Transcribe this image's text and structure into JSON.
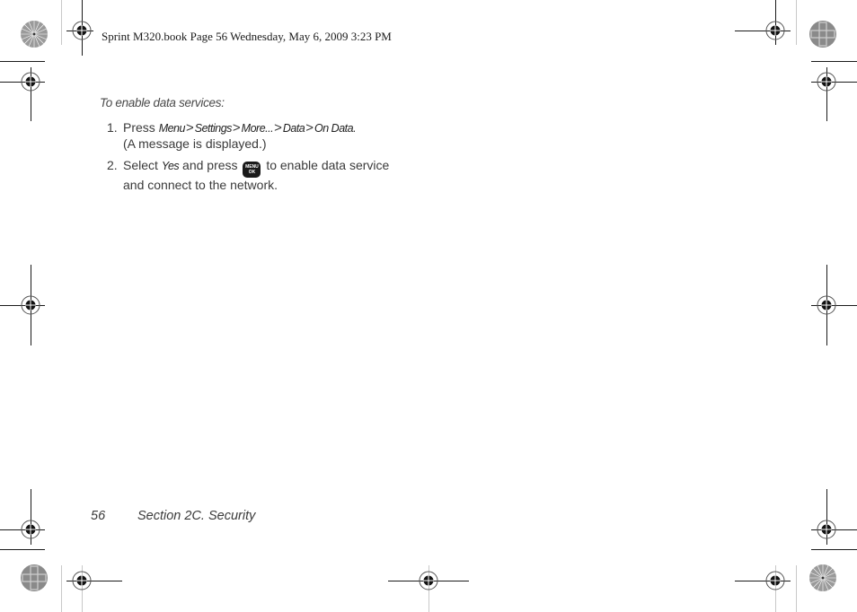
{
  "header": {
    "print_info": "Sprint M320.book  Page 56  Wednesday, May 6, 2009  3:23 PM"
  },
  "content": {
    "intro": "To enable data services:",
    "steps": [
      {
        "number": "1.",
        "prefix": "Press ",
        "path": [
          "Menu",
          "Settings",
          "More...",
          "Data",
          "On Data."
        ],
        "separator": ">",
        "continuation": "(A message is displayed.)"
      },
      {
        "number": "2.",
        "prefix": "Select ",
        "option": "Yes",
        "middle": " and press ",
        "key_icon": "menu-ok-key",
        "key_label_top": "MENU",
        "key_label_bottom": "OK",
        "suffix": " to enable data service",
        "continuation": "and connect to the network."
      }
    ]
  },
  "footer": {
    "page_number": "56",
    "section_title": "Section 2C. Security"
  },
  "marks": {
    "registration_marks": "crosshair-target",
    "color_bars": "starburst-circle"
  }
}
